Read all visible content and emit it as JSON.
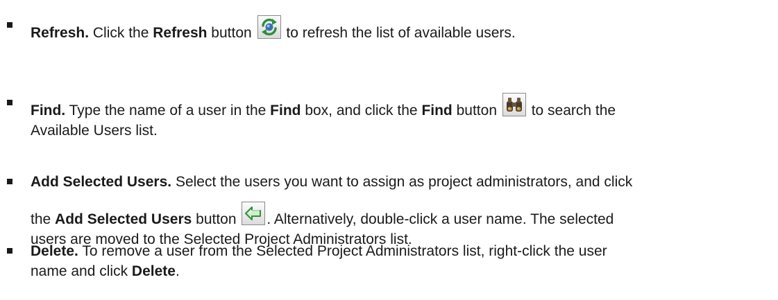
{
  "refresh": {
    "title": "Refresh.",
    "t1": "Click the",
    "button_label": "Refresh",
    "t2": "button",
    "t3": "to refresh the list of available users.",
    "icon": "refresh-icon"
  },
  "find": {
    "title": "Find.",
    "t1": "Type the name of a user in the",
    "box_label": "Find",
    "t2": "box, and click the",
    "button_label": "Find",
    "t3": "button",
    "t4": "to search the",
    "t5": "Available Users list.",
    "icon": "binoculars-icon"
  },
  "add": {
    "title": "Add Selected Users.",
    "t1": "Select the users you want to assign as project administrators, and click",
    "t2": "the",
    "button_label": "Add Selected Users",
    "t3": "button",
    "t4": ". Alternatively, double-click a user name. The selected",
    "t5": "users are moved to the Selected Project Administrators list.",
    "icon": "add-arrow-icon"
  },
  "delete": {
    "title": "Delete.",
    "t1": "To remove a user from the Selected Project Administrators list, right-click the user",
    "t2": "name and click",
    "action_label": "Delete",
    "t3": "."
  }
}
